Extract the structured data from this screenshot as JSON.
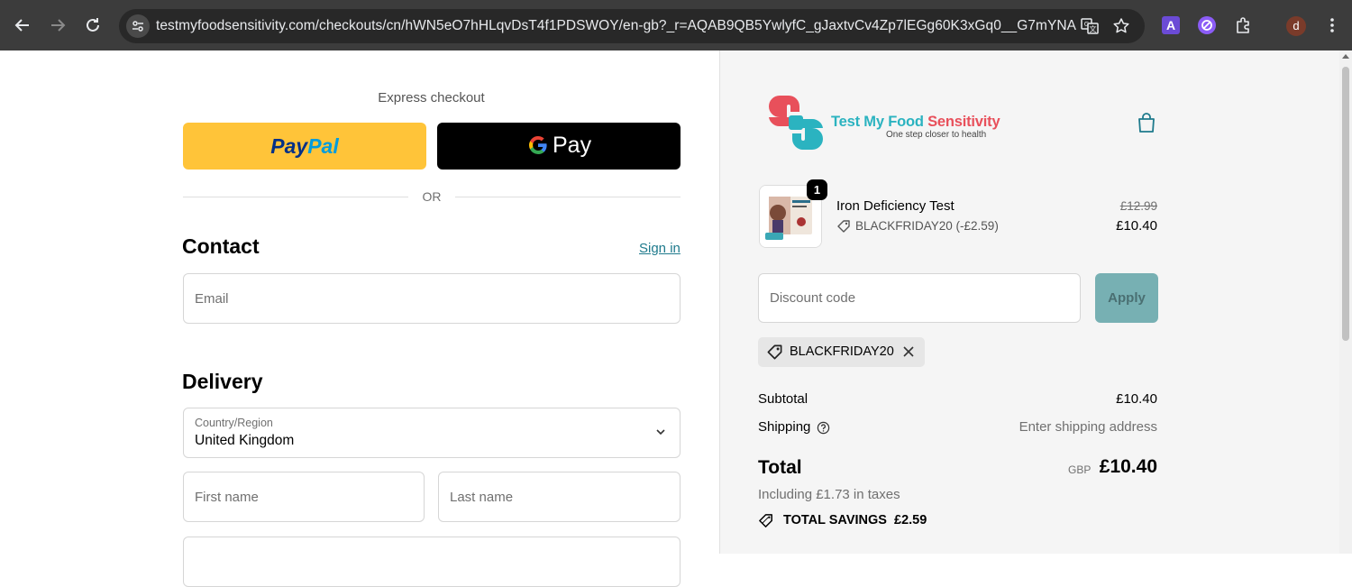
{
  "browser": {
    "url": "testmyfoodsensitivity.com/checkouts/cn/hWN5eO7hHLqvDsT4f1PDSWOY/en-gb?_r=AQAB9QB5YwlyfC_gJaxtvCv4Zp7lEGg60K3xGq0__G7mYNA",
    "profile_initial": "d",
    "extension_a_label": "A",
    "icons": [
      "back-icon",
      "forward-icon",
      "reload-icon",
      "site-settings-icon",
      "translate-icon",
      "bookmark-star-icon",
      "extensions-puzzle-icon",
      "menu-kebab-icon"
    ]
  },
  "checkout": {
    "express_title": "Express checkout",
    "paypal_pay": "Pay",
    "paypal_pal": "Pal",
    "gpay_label": "Pay",
    "or_label": "OR",
    "contact_title": "Contact",
    "sign_in": "Sign in",
    "email_placeholder": "Email",
    "delivery_title": "Delivery",
    "country_label": "Country/Region",
    "country_value": "United Kingdom",
    "first_name_placeholder": "First name",
    "last_name_placeholder": "Last name"
  },
  "summary": {
    "brand_name_part1": "Test My Food ",
    "brand_name_part2": "Sensitivity",
    "brand_tagline": "One step closer to health",
    "product": {
      "name": "Iron Deficiency Test",
      "quantity": "1",
      "discount_note": "BLACKFRIDAY20 (-£2.59)",
      "original_price": "£12.99",
      "price": "£10.40"
    },
    "discount_placeholder": "Discount code",
    "apply_label": "Apply",
    "applied_code": "BLACKFRIDAY20",
    "subtotal_label": "Subtotal",
    "subtotal_value": "£10.40",
    "shipping_label": "Shipping",
    "shipping_value": "Enter shipping address",
    "total_label": "Total",
    "currency": "GBP",
    "total_value": "£10.40",
    "taxes_note": "Including £1.73 in taxes",
    "savings_label": "TOTAL SAVINGS",
    "savings_value": "£2.59"
  },
  "colors": {
    "accent": "#1e7a8c",
    "paypal_yellow": "#ffc439",
    "apply_button": "#77b0b3",
    "brand_teal": "#2bb3c0",
    "brand_red": "#e8505b"
  }
}
